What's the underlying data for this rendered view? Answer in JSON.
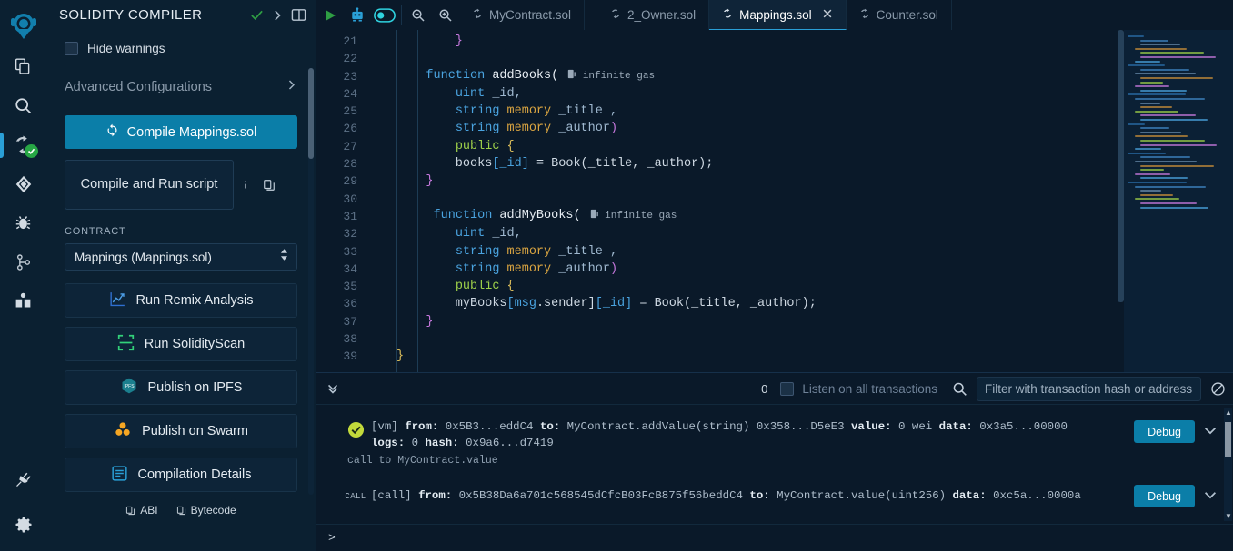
{
  "iconbar": {
    "items": [
      {
        "name": "logo",
        "label": "Remix logo"
      },
      {
        "name": "file-explorer",
        "label": "File explorer"
      },
      {
        "name": "search",
        "label": "Search in files"
      },
      {
        "name": "solidity-compiler",
        "label": "Solidity compiler",
        "active": true,
        "badge": "check"
      },
      {
        "name": "deploy-run",
        "label": "Deploy & run transactions"
      },
      {
        "name": "debugger",
        "label": "Debugger"
      },
      {
        "name": "git",
        "label": "Git"
      },
      {
        "name": "learn",
        "label": "Learn"
      },
      {
        "name": "plugin-manager",
        "label": "Plugin manager"
      },
      {
        "name": "settings",
        "label": "Settings"
      }
    ]
  },
  "panel": {
    "title": "SOLIDITY COMPILER",
    "hide_warnings_label": "Hide warnings",
    "advanced_label": "Advanced Configurations",
    "compile_button": "Compile Mappings.sol",
    "compile_run_button": "Compile and Run script",
    "contract_label": "CONTRACT",
    "contract_value": "Mappings (Mappings.sol)",
    "actions": [
      {
        "icon": "chart-line-icon",
        "label": "Run Remix Analysis"
      },
      {
        "icon": "scan-icon",
        "label": "Run SolidityScan"
      },
      {
        "icon": "ipfs-icon",
        "label": "Publish on IPFS"
      },
      {
        "icon": "swarm-icon",
        "label": "Publish on Swarm"
      },
      {
        "icon": "details-icon",
        "label": "Compilation Details"
      }
    ],
    "abi_label": "ABI",
    "bytecode_label": "Bytecode"
  },
  "tabs": {
    "toolbar_icons": [
      "run-icon",
      "robot-icon",
      "toggle-icon",
      "zoom-out-icon",
      "zoom-in-icon"
    ],
    "items": [
      {
        "label": "MyContract.sol",
        "active": false,
        "closable": false
      },
      {
        "label": "2_Owner.sol",
        "active": false,
        "closable": false
      },
      {
        "label": "Mappings.sol",
        "active": true,
        "closable": true
      },
      {
        "label": "Counter.sol",
        "active": false,
        "closable": false
      }
    ]
  },
  "editor": {
    "gas_hint": "infinite gas",
    "lines": [
      {
        "n": 21,
        "segs": [
          {
            "t": "        }",
            "c": "k-br"
          }
        ]
      },
      {
        "n": 22,
        "segs": []
      },
      {
        "n": 23,
        "segs": [
          {
            "t": "    ",
            "c": "k-white"
          },
          {
            "t": "function",
            "c": "k-fn"
          },
          {
            "t": " addBooks(",
            "c": "k-name"
          }
        ],
        "gas": true
      },
      {
        "n": 24,
        "segs": [
          {
            "t": "        ",
            "c": "k-white"
          },
          {
            "t": "uint",
            "c": "k-type"
          },
          {
            "t": " _id,",
            "c": "k-var"
          }
        ]
      },
      {
        "n": 25,
        "segs": [
          {
            "t": "        ",
            "c": "k-white"
          },
          {
            "t": "string",
            "c": "k-type"
          },
          {
            "t": " ",
            "c": "k-white"
          },
          {
            "t": "memory",
            "c": "k-mem"
          },
          {
            "t": " _title ,",
            "c": "k-var"
          }
        ]
      },
      {
        "n": 26,
        "segs": [
          {
            "t": "        ",
            "c": "k-white"
          },
          {
            "t": "string",
            "c": "k-type"
          },
          {
            "t": " ",
            "c": "k-white"
          },
          {
            "t": "memory",
            "c": "k-mem"
          },
          {
            "t": " _author",
            "c": "k-var"
          },
          {
            "t": ")",
            "c": "k-br"
          }
        ]
      },
      {
        "n": 27,
        "segs": [
          {
            "t": "        ",
            "c": "k-white"
          },
          {
            "t": "public",
            "c": "k-pub"
          },
          {
            "t": " ",
            "c": "k-white"
          },
          {
            "t": "{",
            "c": "k-yel"
          }
        ]
      },
      {
        "n": 28,
        "segs": [
          {
            "t": "        books",
            "c": "k-white"
          },
          {
            "t": "[_id]",
            "c": "k-type"
          },
          {
            "t": " = Book(_title, _author)",
            "c": "k-white"
          },
          {
            "t": ";",
            "c": "k-white"
          }
        ]
      },
      {
        "n": 29,
        "segs": [
          {
            "t": "    ",
            "c": "k-white"
          },
          {
            "t": "}",
            "c": "k-br"
          }
        ]
      },
      {
        "n": 30,
        "segs": []
      },
      {
        "n": 31,
        "segs": [
          {
            "t": "     ",
            "c": "k-white"
          },
          {
            "t": "function",
            "c": "k-fn"
          },
          {
            "t": " addMyBooks(",
            "c": "k-name"
          }
        ],
        "gas": true
      },
      {
        "n": 32,
        "segs": [
          {
            "t": "        ",
            "c": "k-white"
          },
          {
            "t": "uint",
            "c": "k-type"
          },
          {
            "t": " _id,",
            "c": "k-var"
          }
        ]
      },
      {
        "n": 33,
        "segs": [
          {
            "t": "        ",
            "c": "k-white"
          },
          {
            "t": "string",
            "c": "k-type"
          },
          {
            "t": " ",
            "c": "k-white"
          },
          {
            "t": "memory",
            "c": "k-mem"
          },
          {
            "t": " _title ,",
            "c": "k-var"
          }
        ]
      },
      {
        "n": 34,
        "segs": [
          {
            "t": "        ",
            "c": "k-white"
          },
          {
            "t": "string",
            "c": "k-type"
          },
          {
            "t": " ",
            "c": "k-white"
          },
          {
            "t": "memory",
            "c": "k-mem"
          },
          {
            "t": " _author",
            "c": "k-var"
          },
          {
            "t": ")",
            "c": "k-br"
          }
        ]
      },
      {
        "n": 35,
        "segs": [
          {
            "t": "        ",
            "c": "k-white"
          },
          {
            "t": "public",
            "c": "k-pub"
          },
          {
            "t": " ",
            "c": "k-white"
          },
          {
            "t": "{",
            "c": "k-yel"
          }
        ]
      },
      {
        "n": 36,
        "segs": [
          {
            "t": "        myBooks",
            "c": "k-white"
          },
          {
            "t": "[msg",
            "c": "k-type"
          },
          {
            "t": ".sender]",
            "c": "k-white"
          },
          {
            "t": "[_id]",
            "c": "k-type"
          },
          {
            "t": " = Book(_title, _author);",
            "c": "k-white"
          }
        ]
      },
      {
        "n": 37,
        "segs": [
          {
            "t": "    ",
            "c": "k-white"
          },
          {
            "t": "}",
            "c": "k-br"
          }
        ]
      },
      {
        "n": 38,
        "segs": []
      },
      {
        "n": 39,
        "segs": [
          {
            "t": "}",
            "c": "k-yel"
          }
        ]
      }
    ]
  },
  "terminal": {
    "count": "0",
    "listen_label": "Listen on all transactions",
    "filter_placeholder": "Filter with transaction hash or address",
    "prompt": ">",
    "transactions": [
      {
        "status": "success",
        "tag": "",
        "line1_parts": [
          {
            "t": "[vm] ",
            "b": false
          },
          {
            "t": "from:",
            "b": true
          },
          {
            "t": " 0x5B3...eddC4 ",
            "b": false
          },
          {
            "t": "to:",
            "b": true
          },
          {
            "t": " MyContract.addValue(string) 0x358...D5eE3 ",
            "b": false
          },
          {
            "t": "value:",
            "b": true
          },
          {
            "t": " 0 wei ",
            "b": false
          },
          {
            "t": "data:",
            "b": true
          },
          {
            "t": " 0x3a5...00000",
            "b": false
          }
        ],
        "line2_parts": [
          {
            "t": "logs:",
            "b": true
          },
          {
            "t": " 0 ",
            "b": false
          },
          {
            "t": "hash:",
            "b": true
          },
          {
            "t": " 0x9a6...d7419",
            "b": false
          }
        ],
        "sub": "call to MyContract.value",
        "debug_label": "Debug"
      },
      {
        "status": "call",
        "tag": "CALL",
        "line1_parts": [
          {
            "t": "[call] ",
            "b": false
          },
          {
            "t": "from:",
            "b": true
          },
          {
            "t": " 0x5B38Da6a701c568545dCfcB03FcB875f56beddC4 ",
            "b": false
          },
          {
            "t": "to:",
            "b": true
          },
          {
            "t": " MyContract.value(uint256) ",
            "b": false
          },
          {
            "t": "data:",
            "b": true
          },
          {
            "t": " 0xc5a...0000a",
            "b": false
          }
        ],
        "line2_parts": [],
        "sub": "",
        "debug_label": "Debug"
      }
    ]
  },
  "colors": {
    "accent": "#0b7ea8",
    "success": "#27a745",
    "panel_bg": "#0b2031",
    "editor_bg": "#0a1929"
  }
}
